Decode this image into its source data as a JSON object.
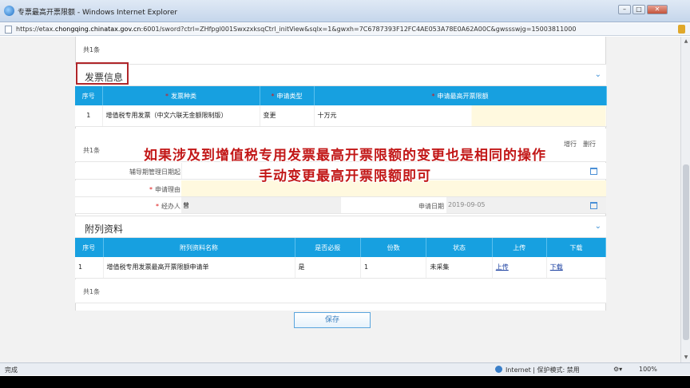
{
  "window": {
    "title": "专票最高开票限额 - Windows Internet Explorer",
    "controls": {
      "minimize": "–",
      "maximize": "□",
      "close": "✕"
    }
  },
  "address": {
    "url_prefix": "https://etax.",
    "url_host": "chongqing.chinatax.gov.cn",
    "url_rest": ":6001/sword?ctrl=ZHfpgl001SwxzxksqCtrl_initView&sqlx=1&gwxh=7C6787393F12FC4AE053A78E0A62A00C&gwssswjg=15003811000"
  },
  "top_count": "共1条",
  "invoice_section": {
    "title": "发票信息",
    "columns": [
      "序号",
      "发票种类",
      "申请类型",
      "申请最高开票限额"
    ],
    "required_mark": "*",
    "rows": [
      {
        "index": "1",
        "type": "增值税专用发票（中文六联无金额限制版）",
        "apply_type": "变更",
        "limit": "十万元"
      }
    ],
    "count": "共1条",
    "row_actions": [
      "增行",
      "删行"
    ]
  },
  "form": {
    "tutor_end_label": "辅导期管理日期起",
    "reason_label": "申请理由",
    "operator_label": "经办人",
    "operator_value": "曾",
    "apply_date_label": "申请日期",
    "apply_date_value": "2019-09-05",
    "required_mark": "*"
  },
  "attachments": {
    "title": "附列资料",
    "columns": [
      "序号",
      "附列资料名称",
      "是否必报",
      "份数",
      "状态",
      "上传",
      "下载"
    ],
    "rows": [
      {
        "index": "1",
        "name": "增值税专用发票最高开票限额申请单",
        "required": "是",
        "copies": "1",
        "status": "未采集",
        "upload": "上传",
        "download": "下载"
      }
    ],
    "count": "共1条"
  },
  "save_button": "保存",
  "overlay": {
    "line1": "如果涉及到增值税专用发票最高开票限额的变更也是相同的操作",
    "line2": "手动变更最高开票限额即可"
  },
  "status_bar": {
    "left": "完成",
    "zone": "Internet | 保护模式: 禁用",
    "zoom": "100%"
  },
  "colors": {
    "header_blue": "#17a0e0",
    "highlight_red": "#b0262a",
    "overlay_text": "#c21717",
    "required_red": "#d11111"
  }
}
